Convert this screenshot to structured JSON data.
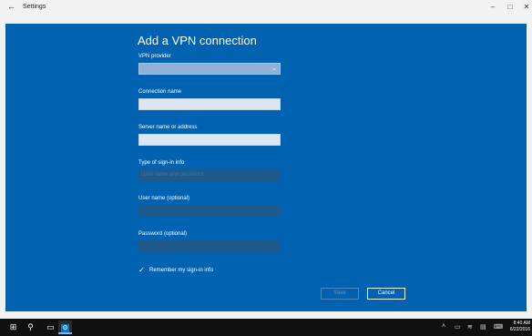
{
  "window": {
    "title": "Settings",
    "back_glyph": "←",
    "minimize_glyph": "–",
    "maximize_glyph": "□",
    "close_glyph": "✕"
  },
  "dialog": {
    "title": "Add a VPN connection",
    "vpn_provider": {
      "label": "VPN provider",
      "value": "",
      "icon": "chevron-down-icon"
    },
    "connection_name": {
      "label": "Connection name",
      "value": ""
    },
    "server": {
      "label": "Server name or address",
      "value": ""
    },
    "sign_in_type": {
      "label": "Type of sign-in info",
      "value": "User name and password"
    },
    "username": {
      "label": "User name (optional)",
      "value": ""
    },
    "password": {
      "label": "Password (optional)",
      "value": ""
    },
    "remember": {
      "label": "Remember my sign-in info",
      "checked": true
    },
    "save_label": "Save",
    "cancel_label": "Cancel"
  },
  "taskbar": {
    "start_icon": "windows-start-icon",
    "search_icon": "search-icon",
    "task_view_icon": "task-view-icon",
    "settings_app_icon": "gear-icon",
    "time": "8:40 AM",
    "date": "6/22/2016"
  },
  "colors": {
    "dialog_bg": "#0063b1",
    "taskbar_bg": "#101010",
    "accent": "#0078d7"
  }
}
